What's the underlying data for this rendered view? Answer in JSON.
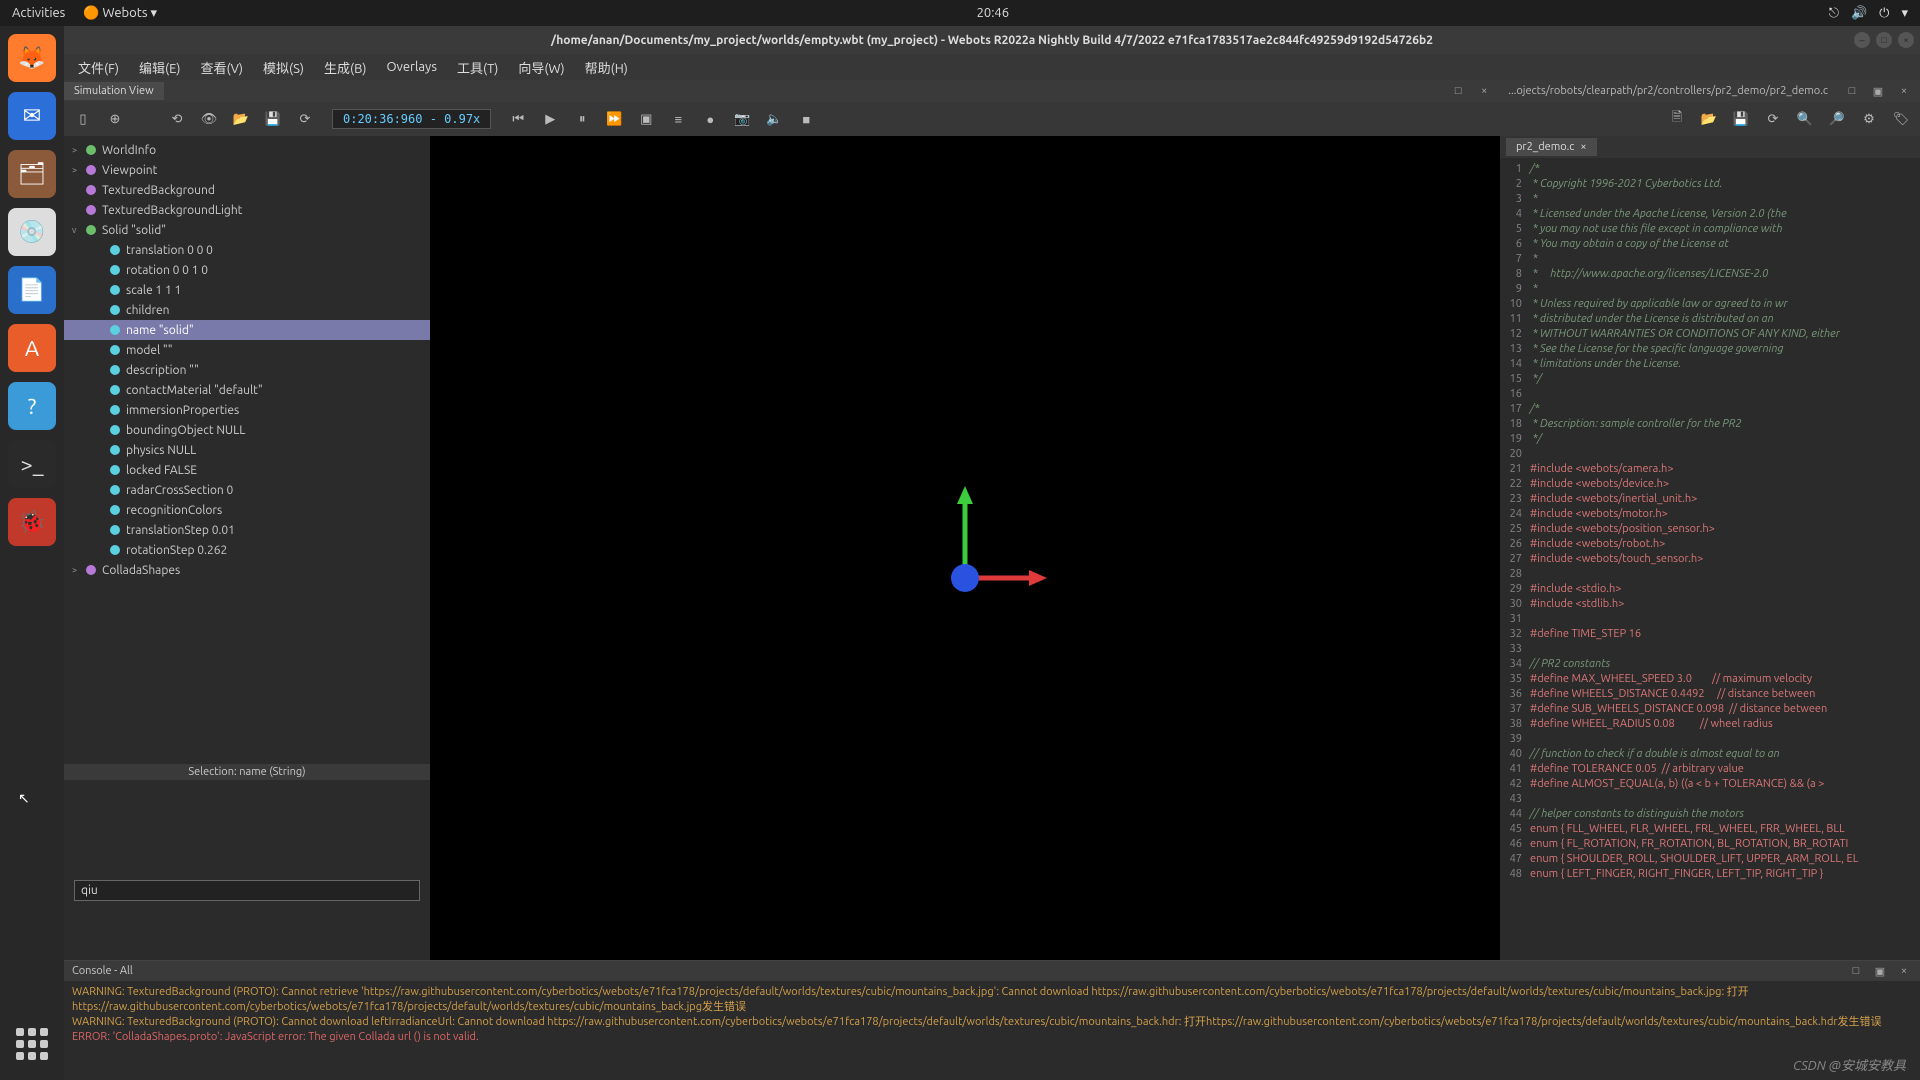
{
  "topbar": {
    "activities": "Activities",
    "app": "Webots",
    "time": "20:46"
  },
  "window_title": "/home/anan/Documents/my_project/worlds/empty.wbt (my_project) - Webots R2022a Nightly Build 4/7/2022 e71fca1783517ae2c844fc49259d9192d54726b2",
  "menus": {
    "file": "文件(F)",
    "edit": "编辑(E)",
    "view": "查看(V)",
    "sim": "模拟(S)",
    "build": "生成(B)",
    "overlays": "Overlays",
    "tools": "工具(T)",
    "wizard": "向导(W)",
    "help": "帮助(H)"
  },
  "tab_sim": "Simulation View",
  "editor_path": "...ojects/robots/clearpath/pr2/controllers/pr2_demo/pr2_demo.c",
  "time_display": "0:20:36:960   -   0.97x",
  "tree": [
    {
      "exp": ">",
      "color": "#6bbf6b",
      "label": "WorldInfo",
      "i": 0
    },
    {
      "exp": ">",
      "color": "#b878d8",
      "label": "Viewpoint",
      "i": 0,
      "cls": "link"
    },
    {
      "exp": "",
      "color": "#b878d8",
      "label": "TexturedBackground",
      "i": 0
    },
    {
      "exp": "",
      "color": "#b878d8",
      "label": "TexturedBackgroundLight",
      "i": 0
    },
    {
      "exp": "v",
      "color": "#6bbf6b",
      "label": "Solid \"solid\"",
      "i": 0
    },
    {
      "exp": "",
      "color": "#5bd0e0",
      "label": "translation 0 0 0",
      "i": 1
    },
    {
      "exp": "",
      "color": "#5bd0e0",
      "label": "rotation 0 0 1 0",
      "i": 1
    },
    {
      "exp": "",
      "color": "#5bd0e0",
      "label": "scale 1 1 1",
      "i": 1
    },
    {
      "exp": "",
      "color": "#5bd0e0",
      "label": "children",
      "i": 1
    },
    {
      "exp": "",
      "color": "#5bd0e0",
      "label": "name \"solid\"",
      "i": 1,
      "sel": true
    },
    {
      "exp": "",
      "color": "#5bd0e0",
      "label": "model \"\"",
      "i": 1
    },
    {
      "exp": "",
      "color": "#5bd0e0",
      "label": "description \"\"",
      "i": 1
    },
    {
      "exp": "",
      "color": "#5bd0e0",
      "label": "contactMaterial \"default\"",
      "i": 1
    },
    {
      "exp": "",
      "color": "#5bd0e0",
      "label": "immersionProperties",
      "i": 1
    },
    {
      "exp": "",
      "color": "#5bd0e0",
      "label": "boundingObject NULL",
      "i": 1
    },
    {
      "exp": "",
      "color": "#5bd0e0",
      "label": "physics NULL",
      "i": 1
    },
    {
      "exp": "",
      "color": "#5bd0e0",
      "label": "locked FALSE",
      "i": 1
    },
    {
      "exp": "",
      "color": "#5bd0e0",
      "label": "radarCrossSection 0",
      "i": 1
    },
    {
      "exp": "",
      "color": "#5bd0e0",
      "label": "recognitionColors",
      "i": 1
    },
    {
      "exp": "",
      "color": "#5bd0e0",
      "label": "translationStep 0.01",
      "i": 1
    },
    {
      "exp": "",
      "color": "#5bd0e0",
      "label": "rotationStep 0.262",
      "i": 1
    },
    {
      "exp": ">",
      "color": "#b878d8",
      "label": "ColladaShapes",
      "i": 0
    }
  ],
  "selection_label": "Selection: name (String)",
  "input_value": "qiu",
  "editor_tab": "pr2_demo.c",
  "code": [
    {
      "n": 1,
      "t": "/*",
      "c": "cm"
    },
    {
      "n": 2,
      "t": " * Copyright 1996-2021 Cyberbotics Ltd.",
      "c": "cm"
    },
    {
      "n": 3,
      "t": " *",
      "c": "cm"
    },
    {
      "n": 4,
      "t": " * Licensed under the Apache License, Version 2.0 (the",
      "c": "cm"
    },
    {
      "n": 5,
      "t": " * you may not use this file except in compliance with",
      "c": "cm"
    },
    {
      "n": 6,
      "t": " * You may obtain a copy of the License at",
      "c": "cm"
    },
    {
      "n": 7,
      "t": " *",
      "c": "cm"
    },
    {
      "n": 8,
      "t": " *     http://www.apache.org/licenses/LICENSE-2.0",
      "c": "cm"
    },
    {
      "n": 9,
      "t": " *",
      "c": "cm"
    },
    {
      "n": 10,
      "t": " * Unless required by applicable law or agreed to in wr",
      "c": "cm"
    },
    {
      "n": 11,
      "t": " * distributed under the License is distributed on an",
      "c": "cm"
    },
    {
      "n": 12,
      "t": " * WITHOUT WARRANTIES OR CONDITIONS OF ANY KIND, either",
      "c": "cm"
    },
    {
      "n": 13,
      "t": " * See the License for the specific language governing",
      "c": "cm"
    },
    {
      "n": 14,
      "t": " * limitations under the License.",
      "c": "cm"
    },
    {
      "n": 15,
      "t": " */",
      "c": "cm"
    },
    {
      "n": 16,
      "t": "",
      "c": ""
    },
    {
      "n": 17,
      "t": "/*",
      "c": "cm"
    },
    {
      "n": 18,
      "t": " * Description: sample controller for the PR2",
      "c": "cm"
    },
    {
      "n": 19,
      "t": " */",
      "c": "cm"
    },
    {
      "n": 20,
      "t": "",
      "c": ""
    },
    {
      "n": 21,
      "t": "#include <webots/camera.h>",
      "c": "pp"
    },
    {
      "n": 22,
      "t": "#include <webots/device.h>",
      "c": "pp"
    },
    {
      "n": 23,
      "t": "#include <webots/inertial_unit.h>",
      "c": "pp"
    },
    {
      "n": 24,
      "t": "#include <webots/motor.h>",
      "c": "pp"
    },
    {
      "n": 25,
      "t": "#include <webots/position_sensor.h>",
      "c": "pp"
    },
    {
      "n": 26,
      "t": "#include <webots/robot.h>",
      "c": "pp"
    },
    {
      "n": 27,
      "t": "#include <webots/touch_sensor.h>",
      "c": "pp"
    },
    {
      "n": 28,
      "t": "",
      "c": ""
    },
    {
      "n": 29,
      "t": "#include <stdio.h>",
      "c": "pp"
    },
    {
      "n": 30,
      "t": "#include <stdlib.h>",
      "c": "pp"
    },
    {
      "n": 31,
      "t": "",
      "c": ""
    },
    {
      "n": 32,
      "t": "#define TIME_STEP 16",
      "c": "pp"
    },
    {
      "n": 33,
      "t": "",
      "c": ""
    },
    {
      "n": 34,
      "t": "// PR2 constants",
      "c": "cm"
    },
    {
      "n": 35,
      "t": "#define MAX_WHEEL_SPEED 3.0        // maximum velocity",
      "c": "pp"
    },
    {
      "n": 36,
      "t": "#define WHEELS_DISTANCE 0.4492     // distance between",
      "c": "pp"
    },
    {
      "n": 37,
      "t": "#define SUB_WHEELS_DISTANCE 0.098  // distance between",
      "c": "pp"
    },
    {
      "n": 38,
      "t": "#define WHEEL_RADIUS 0.08          // wheel radius",
      "c": "pp"
    },
    {
      "n": 39,
      "t": "",
      "c": ""
    },
    {
      "n": 40,
      "t": "// function to check if a double is almost equal to an",
      "c": "cm"
    },
    {
      "n": 41,
      "t": "#define TOLERANCE 0.05  // arbitrary value",
      "c": "pp"
    },
    {
      "n": 42,
      "t": "#define ALMOST_EQUAL(a, b) ((a < b + TOLERANCE) && (a >",
      "c": "pp"
    },
    {
      "n": 43,
      "t": "",
      "c": ""
    },
    {
      "n": 44,
      "t": "// helper constants to distinguish the motors",
      "c": "cm"
    },
    {
      "n": 45,
      "t": "enum { FLL_WHEEL, FLR_WHEEL, FRL_WHEEL, FRR_WHEEL, BLL",
      "c": "kw"
    },
    {
      "n": 46,
      "t": "enum { FL_ROTATION, FR_ROTATION, BL_ROTATION, BR_ROTATI",
      "c": "kw"
    },
    {
      "n": 47,
      "t": "enum { SHOULDER_ROLL, SHOULDER_LIFT, UPPER_ARM_ROLL, EL",
      "c": "kw"
    },
    {
      "n": 48,
      "t": "enum { LEFT_FINGER, RIGHT_FINGER, LEFT_TIP, RIGHT_TIP }",
      "c": "kw"
    }
  ],
  "console_title": "Console - All",
  "console": [
    {
      "c": "warn",
      "t": "WARNING: TexturedBackground (PROTO): Cannot retrieve 'https://raw.githubusercontent.com/cyberbotics/webots/e71fca178/projects/default/worlds/textures/cubic/mountains_back.jpg': Cannot download https://raw.githubusercontent.com/cyberbotics/webots/e71fca178/projects/default/worlds/textures/cubic/mountains_back.jpg: 打开https://raw.githubusercontent.com/cyberbotics/webots/e71fca178/projects/default/worlds/textures/cubic/mountains_back.jpg发生错误"
    },
    {
      "c": "warn",
      "t": "WARNING: TexturedBackground (PROTO): Cannot download leftIrradianceUrl: Cannot download https://raw.githubusercontent.com/cyberbotics/webots/e71fca178/projects/default/worlds/textures/cubic/mountains_back.hdr: 打开https://raw.githubusercontent.com/cyberbotics/webots/e71fca178/projects/default/worlds/textures/cubic/mountains_back.hdr发生错误"
    },
    {
      "c": "err",
      "t": "ERROR: 'ColladaShapes.proto': JavaScript error: The given Collada url () is not valid."
    }
  ],
  "watermark": "CSDN @安城安教具"
}
